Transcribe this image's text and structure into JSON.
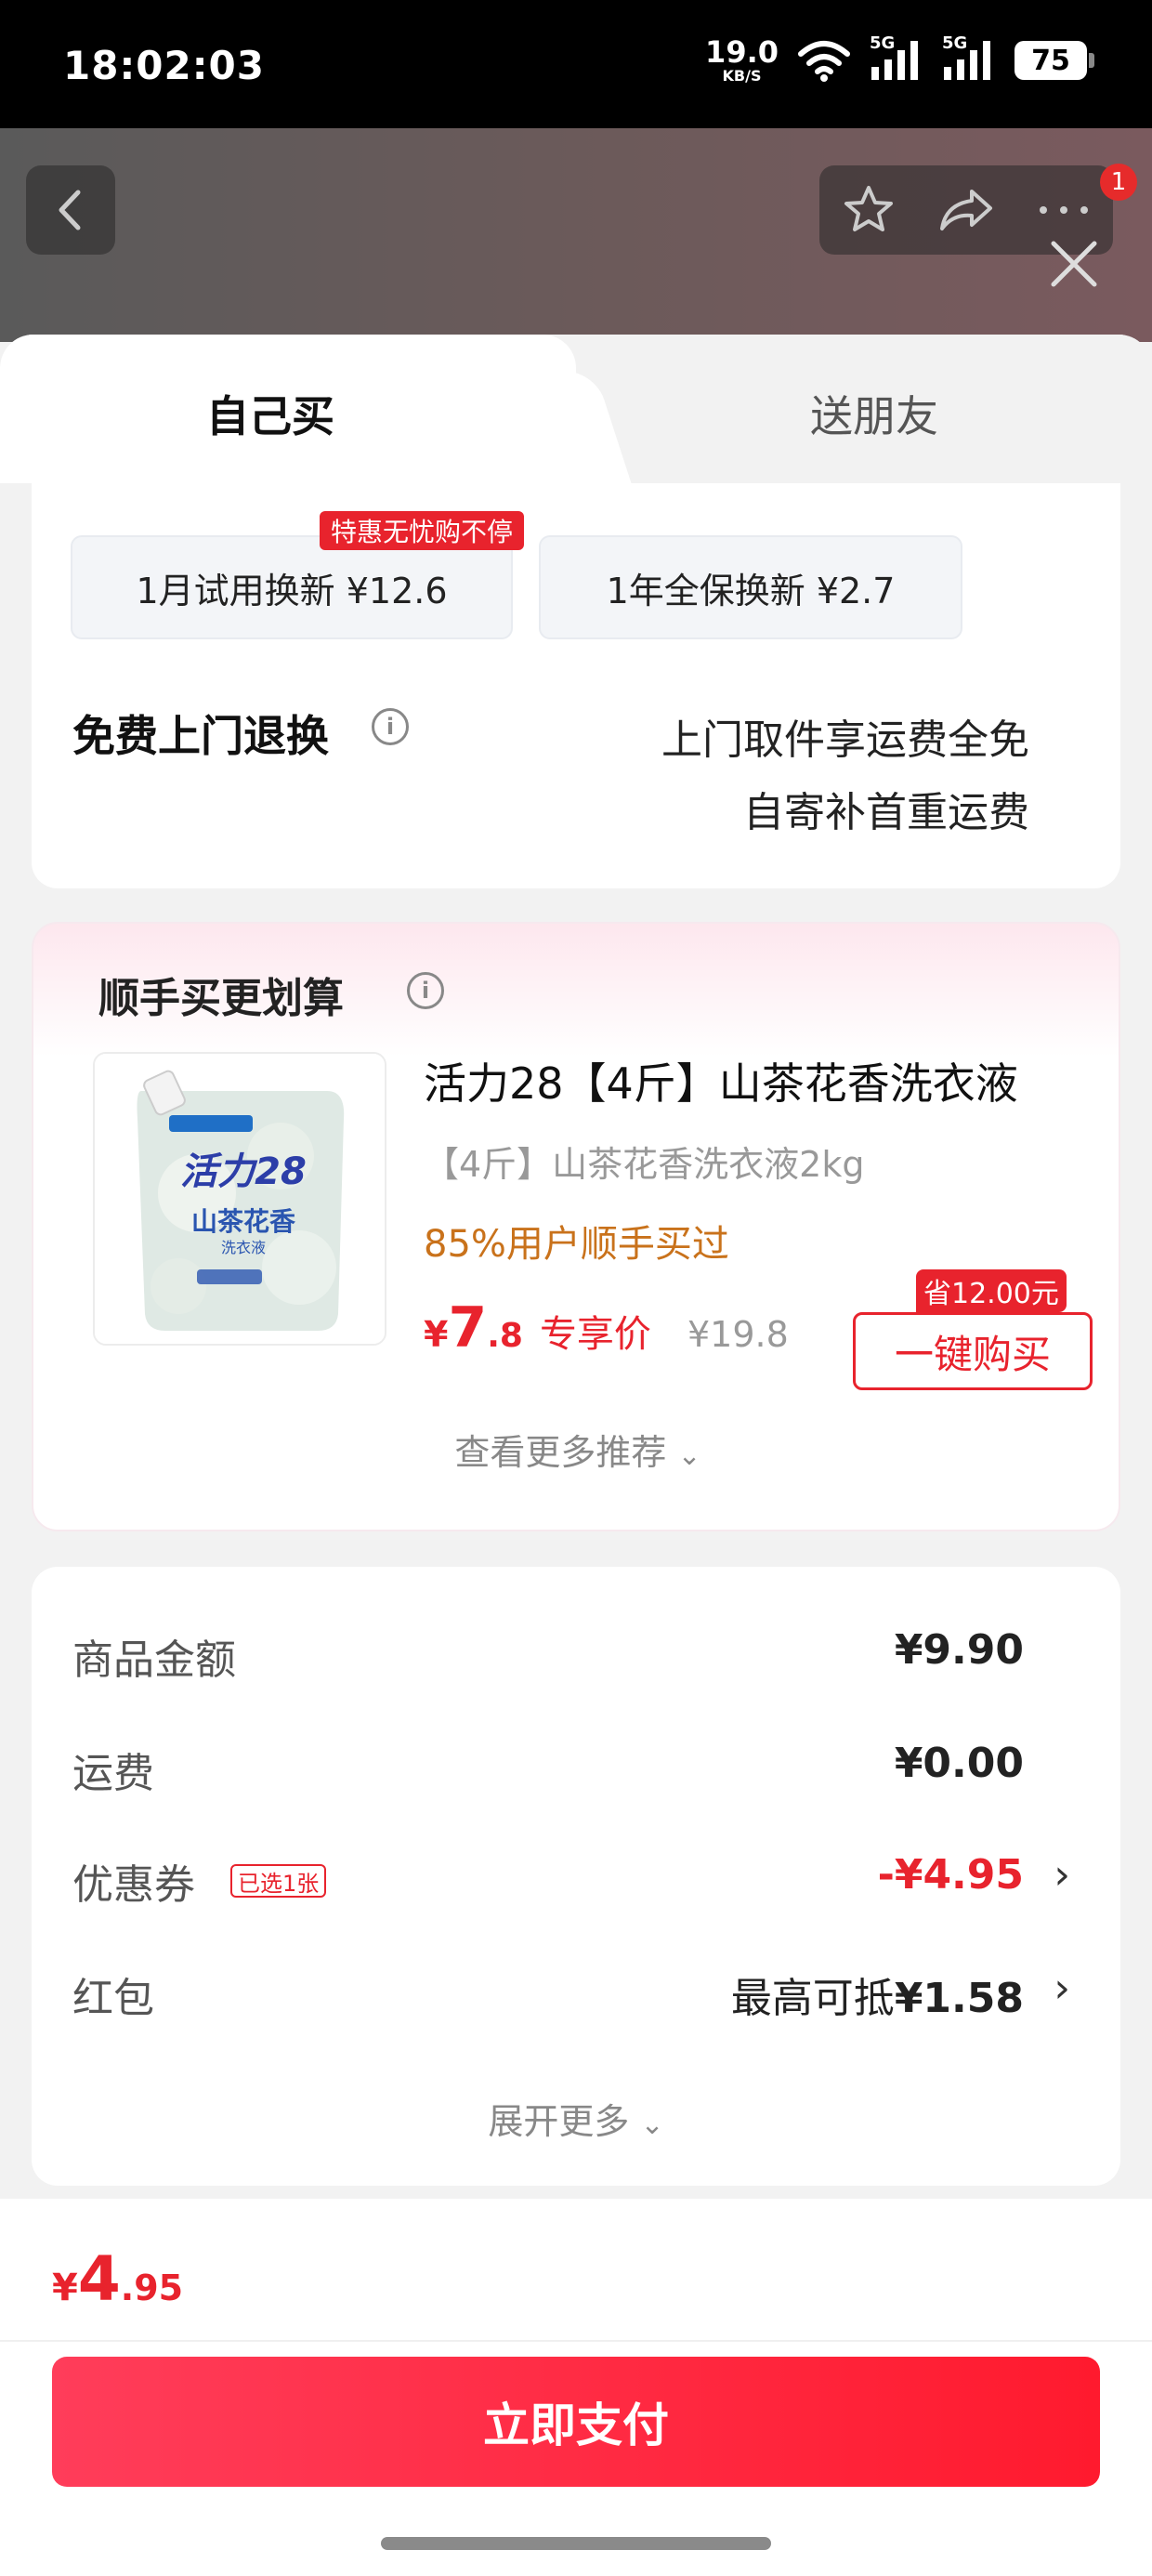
{
  "status_bar": {
    "time": "18:02:03",
    "net_speed": "19.0",
    "net_unit": "KB/S",
    "signal1": "5G",
    "signal2": "5G",
    "battery": "75"
  },
  "header": {
    "cart_badge": "1"
  },
  "tabs": [
    {
      "label": "自己买",
      "active": true
    },
    {
      "label": "送朋友",
      "active": false
    }
  ],
  "warranty": {
    "option1": "1月试用换新 ¥12.6",
    "option1_tag": "特惠无忧购不停",
    "option2": "1年全保换新 ¥2.7",
    "return_title": "免费上门退换",
    "return_line1": "上门取件享运费全免",
    "return_line2": "自寄补首重运费"
  },
  "recommend": {
    "title": "顺手买更划算",
    "product": {
      "name": "活力28【4斤】山茶花香洗衣液",
      "spec": "【4斤】山茶花香洗衣液2kg",
      "buyers": "85%用户顺手买过",
      "price_symbol": "¥",
      "price_int": "7",
      "price_dec": ".8",
      "price_label": "专享价",
      "original_price": "¥19.8",
      "buy_label": "一键购买",
      "save_tag": "省12.00元",
      "image_brand": "活力28",
      "image_text1": "山茶花香",
      "image_text2": "洗衣液"
    },
    "more": "查看更多推荐"
  },
  "summary": {
    "goods_label": "商品金额",
    "goods_value": "¥9.90",
    "shipping_label": "运费",
    "shipping_value": "¥0.00",
    "coupon_label": "优惠券",
    "coupon_tag": "已选1张",
    "coupon_value": "-¥4.95",
    "redpacket_label": "红包",
    "redpacket_prefix": "最高可抵",
    "redpacket_value": "¥1.58",
    "expand": "展开更多"
  },
  "footer": {
    "total_symbol": "¥",
    "total_int": "4",
    "total_dec": ".95",
    "pay_label": "立即支付"
  },
  "colors": {
    "accent_red": "#e8232d",
    "pay_button": "#ff1a2e",
    "buyers_orange": "#c9721b"
  }
}
